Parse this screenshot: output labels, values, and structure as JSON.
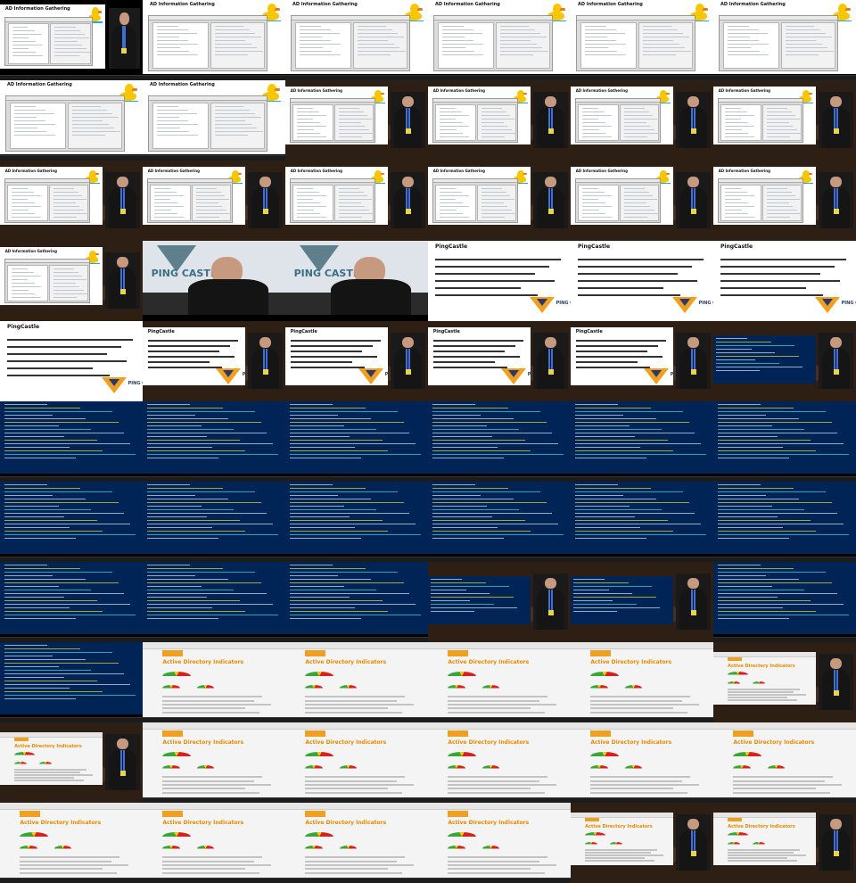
{
  "sheet": {
    "columns": 6,
    "rows": 11,
    "background": "#2a1d14"
  },
  "text": {
    "ad_title": "AD Information Gathering",
    "pingcastle_title": "PingCastle",
    "pingcastle_logo": "PING CASTLE",
    "report_title": "Active Directory Indicators"
  },
  "colors": {
    "powershell_bg": "#012456",
    "report_accent": "#f0a020",
    "duck_yellow": "#f7c600",
    "gauge_green": "#37a537",
    "gauge_yellow": "#f0d000",
    "gauge_red": "#d82020"
  },
  "tiles": [
    {
      "kind": "ad-presenter"
    },
    {
      "kind": "ad"
    },
    {
      "kind": "ad"
    },
    {
      "kind": "ad"
    },
    {
      "kind": "ad"
    },
    {
      "kind": "ad"
    },
    {
      "kind": "ad"
    },
    {
      "kind": "ad"
    },
    {
      "kind": "ad-presenter-small"
    },
    {
      "kind": "ad-presenter-small"
    },
    {
      "kind": "ad-presenter-small"
    },
    {
      "kind": "ad-presenter-small"
    },
    {
      "kind": "ad-presenter-small"
    },
    {
      "kind": "ad-presenter-small"
    },
    {
      "kind": "ad-presenter-small"
    },
    {
      "kind": "ad-presenter-small"
    },
    {
      "kind": "ad-presenter-small"
    },
    {
      "kind": "ad-presenter-small"
    },
    {
      "kind": "ad-presenter-small"
    },
    {
      "kind": "camera"
    },
    {
      "kind": "camera"
    },
    {
      "kind": "pc-slide"
    },
    {
      "kind": "pc-slide"
    },
    {
      "kind": "pc-slide"
    },
    {
      "kind": "pc-slide"
    },
    {
      "kind": "pc-presenter"
    },
    {
      "kind": "pc-presenter"
    },
    {
      "kind": "pc-presenter"
    },
    {
      "kind": "pc-presenter"
    },
    {
      "kind": "ps-presenter"
    },
    {
      "kind": "ps"
    },
    {
      "kind": "ps"
    },
    {
      "kind": "ps"
    },
    {
      "kind": "ps"
    },
    {
      "kind": "ps"
    },
    {
      "kind": "ps"
    },
    {
      "kind": "ps"
    },
    {
      "kind": "ps"
    },
    {
      "kind": "ps"
    },
    {
      "kind": "ps"
    },
    {
      "kind": "ps"
    },
    {
      "kind": "ps"
    },
    {
      "kind": "ps"
    },
    {
      "kind": "ps"
    },
    {
      "kind": "ps"
    },
    {
      "kind": "ps-presenter"
    },
    {
      "kind": "ps-presenter"
    },
    {
      "kind": "ps"
    },
    {
      "kind": "ps"
    },
    {
      "kind": "report"
    },
    {
      "kind": "report"
    },
    {
      "kind": "report"
    },
    {
      "kind": "report"
    },
    {
      "kind": "report-presenter"
    },
    {
      "kind": "report-presenter"
    },
    {
      "kind": "report"
    },
    {
      "kind": "report"
    },
    {
      "kind": "report"
    },
    {
      "kind": "report"
    },
    {
      "kind": "report"
    },
    {
      "kind": "report"
    },
    {
      "kind": "report"
    },
    {
      "kind": "report"
    },
    {
      "kind": "report"
    },
    {
      "kind": "report-presenter"
    },
    {
      "kind": "report-presenter"
    }
  ]
}
